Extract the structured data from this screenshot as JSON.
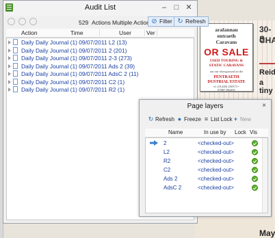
{
  "audit_window": {
    "title": "Audit List",
    "count": "529",
    "actions_label": "Actions",
    "multiple_actions_label": "Multiple Actions",
    "filter_label": "Filter",
    "refresh_label": "Refresh",
    "columns": [
      "Action",
      "Time",
      "User",
      "Ver"
    ],
    "rows": [
      "Daily Daily Journal (1) 09/07/2011 L2 (13)",
      "Daily Daily Journal (1) 09/07/2011 2 (201)",
      "Daily Daily Journal (1) 09/07/2011 2-3 (273)",
      "Daily Daily Journal (1) 09/07/2011 Ads 2 (39)",
      "Daily Daily Journal (1) 09/07/2011 AdsC 2 (11)",
      "Daily Daily Journal (1) 09/07/2011 C2 (1)",
      "Daily Daily Journal (1) 09/07/2011 R2 (1)"
    ]
  },
  "layers_window": {
    "title": "Page layers",
    "close_label": "×",
    "toolbar": {
      "refresh_label": "Refresh",
      "freeze_label": "Freeze",
      "list_lock_label": "List Lock",
      "new_label": "New"
    },
    "columns": [
      "Name",
      "In use by",
      "Lock",
      "Vis"
    ],
    "rows": [
      {
        "name": "2",
        "in_use_by": "<checked-out>"
      },
      {
        "name": "L2",
        "in_use_by": "<checked-out>"
      },
      {
        "name": "R2",
        "in_use_by": "<checked-out>"
      },
      {
        "name": "C2",
        "in_use_by": "<checked-out>"
      },
      {
        "name": "Ads 2",
        "in_use_by": "<checked-out>"
      },
      {
        "name": "AdsC 2",
        "in_use_by": "<checked-out>"
      }
    ]
  },
  "background_page": {
    "ad_lines": [
      "arafannau",
      "entraeth",
      "Caravans",
      "OR SALE",
      "USED TOURING &",
      "STATIC CARAVANS",
      "out our showground on the",
      "PENTRAETH",
      "DUSTRIAL ESTATE",
      "el: (01248) 450373 •",
      "07887 802491"
    ],
    "side_text": [
      "30-S",
      "CHA",
      "Reid",
      "a tiny",
      "May"
    ]
  },
  "colors": {
    "link_blue": "#1a3fa0",
    "sale_red": "#d01818",
    "vis_green": "#5aae2c"
  }
}
